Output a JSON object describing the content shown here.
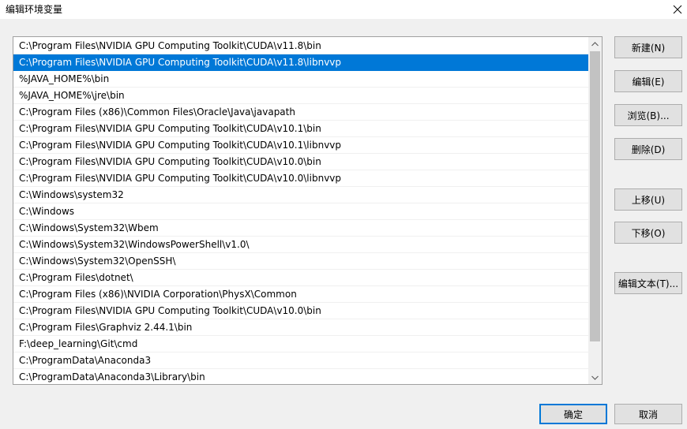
{
  "window": {
    "title": "编辑环境变量",
    "close_icon": "close-icon"
  },
  "paths": [
    "C:\\Program Files\\NVIDIA GPU Computing Toolkit\\CUDA\\v11.8\\bin",
    "C:\\Program Files\\NVIDIA GPU Computing Toolkit\\CUDA\\v11.8\\libnvvp",
    "%JAVA_HOME%\\bin",
    "%JAVA_HOME%\\jre\\bin",
    "C:\\Program Files (x86)\\Common Files\\Oracle\\Java\\javapath",
    "C:\\Program Files\\NVIDIA GPU Computing Toolkit\\CUDA\\v10.1\\bin",
    "C:\\Program Files\\NVIDIA GPU Computing Toolkit\\CUDA\\v10.1\\libnvvp",
    "C:\\Program Files\\NVIDIA GPU Computing Toolkit\\CUDA\\v10.0\\bin",
    "C:\\Program Files\\NVIDIA GPU Computing Toolkit\\CUDA\\v10.0\\libnvvp",
    "C:\\Windows\\system32",
    "C:\\Windows",
    "C:\\Windows\\System32\\Wbem",
    "C:\\Windows\\System32\\WindowsPowerShell\\v1.0\\",
    "C:\\Windows\\System32\\OpenSSH\\",
    "C:\\Program Files\\dotnet\\",
    "C:\\Program Files (x86)\\NVIDIA Corporation\\PhysX\\Common",
    "C:\\Program Files\\NVIDIA GPU Computing Toolkit\\CUDA\\v10.0\\bin",
    "C:\\Program Files\\Graphviz 2.44.1\\bin",
    "F:\\deep_learning\\Git\\cmd",
    "C:\\ProgramData\\Anaconda3",
    "C:\\ProgramData\\Anaconda3\\Library\\bin"
  ],
  "selected_index": 1,
  "buttons": {
    "new": "新建(N)",
    "edit": "编辑(E)",
    "browse": "浏览(B)...",
    "delete": "删除(D)",
    "move_up": "上移(U)",
    "move_down": "下移(O)",
    "edit_text": "编辑文本(T)...",
    "ok": "确定",
    "cancel": "取消"
  },
  "colors": {
    "selection": "#0078d7",
    "background": "#f0f0f0",
    "button_face": "#e1e1e1"
  }
}
